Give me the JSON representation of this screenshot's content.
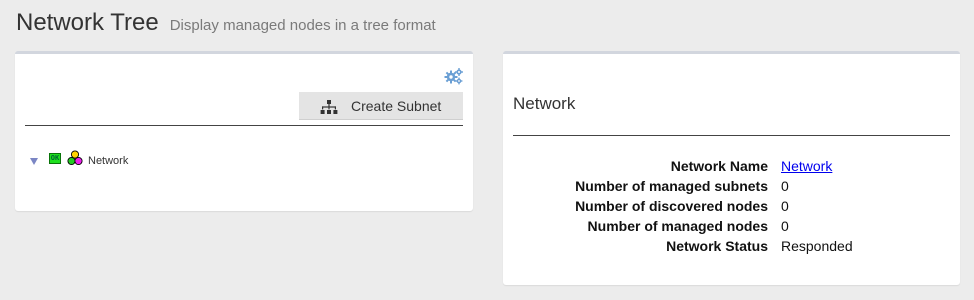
{
  "header": {
    "title": "Network Tree",
    "subtitle": "Display managed nodes in a tree format"
  },
  "left_panel": {
    "settings_icon": "gears-icon",
    "create_subnet_button": {
      "icon": "sitemap-icon",
      "label": "Create Subnet"
    },
    "tree": [
      {
        "expanded": true,
        "status_badge": "OK",
        "status_color": "#1ee01e",
        "icon": "network-circles-icon",
        "label": "Network"
      }
    ]
  },
  "right_panel": {
    "title": "Network",
    "details": [
      {
        "key": "Network Name",
        "separator": ":",
        "value": "Network",
        "is_link": true
      },
      {
        "key": "Number of managed subnets",
        "separator": ":",
        "value": "0"
      },
      {
        "key": "Number of discovered nodes",
        "separator": ":",
        "value": "0"
      },
      {
        "key": "Number of managed nodes",
        "separator": ":",
        "value": "0"
      },
      {
        "key": "Network Status",
        "separator": ":",
        "value": "Responded"
      }
    ]
  },
  "colors": {
    "background": "#ececec",
    "panel_border": "#d2d6de",
    "link": "#0000ee",
    "ok_badge": "#1ee01e",
    "gear_icon": "#6a9fd4",
    "tree_toggle": "#7b86c4"
  }
}
